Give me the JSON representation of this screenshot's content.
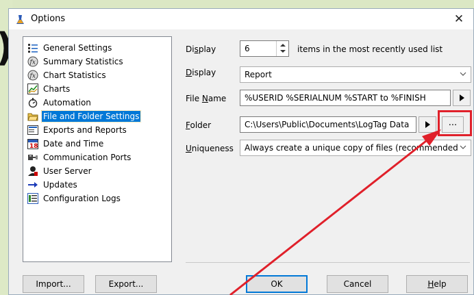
{
  "window": {
    "title": "Options",
    "close_glyph": "✕"
  },
  "background": {
    "paren": ")"
  },
  "tree": {
    "items": [
      {
        "label": "General Settings",
        "icon": "general-settings-icon"
      },
      {
        "label": "Summary Statistics",
        "icon": "statistics-icon"
      },
      {
        "label": "Chart Statistics",
        "icon": "statistics-icon"
      },
      {
        "label": "Charts",
        "icon": "chart-icon"
      },
      {
        "label": "Automation",
        "icon": "automation-icon"
      },
      {
        "label": "File and Folder Settings",
        "icon": "folder-icon",
        "selected": true
      },
      {
        "label": "Exports and Reports",
        "icon": "export-icon"
      },
      {
        "label": "Date and Time",
        "icon": "calendar-icon"
      },
      {
        "label": "Communication Ports",
        "icon": "port-icon"
      },
      {
        "label": "User Server",
        "icon": "user-icon"
      },
      {
        "label": "Updates",
        "icon": "arrow-icon"
      },
      {
        "label": "Configuration Logs",
        "icon": "log-icon"
      }
    ]
  },
  "form": {
    "display1_label_pre": "Di",
    "display1_label_u": "s",
    "display1_label_post": "play",
    "display1_value": "6",
    "display1_suffix": "items in the most recently used list",
    "display2_label_pre": "",
    "display2_label_u": "D",
    "display2_label_post": "isplay",
    "display2_value": "Report",
    "filename_label_pre": "File ",
    "filename_label_u": "N",
    "filename_label_post": "ame",
    "filename_value": "%USERID %SERIALNUM %START to %FINISH",
    "folder_label_pre": "",
    "folder_label_u": "F",
    "folder_label_post": "older",
    "folder_value": "C:\\Users\\Public\\Documents\\LogTag Data",
    "ellipsis_label": "...",
    "uniqueness_label_pre": "",
    "uniqueness_label_u": "U",
    "uniqueness_label_post": "niqueness",
    "uniqueness_value": "Always create a unique copy of files (recommended"
  },
  "buttons": {
    "import": "Import...",
    "export": "Export...",
    "ok": "OK",
    "cancel": "Cancel",
    "help_u": "H",
    "help_rest": "elp"
  },
  "colors": {
    "selection": "#0078d7",
    "annotation": "#e0202a"
  }
}
